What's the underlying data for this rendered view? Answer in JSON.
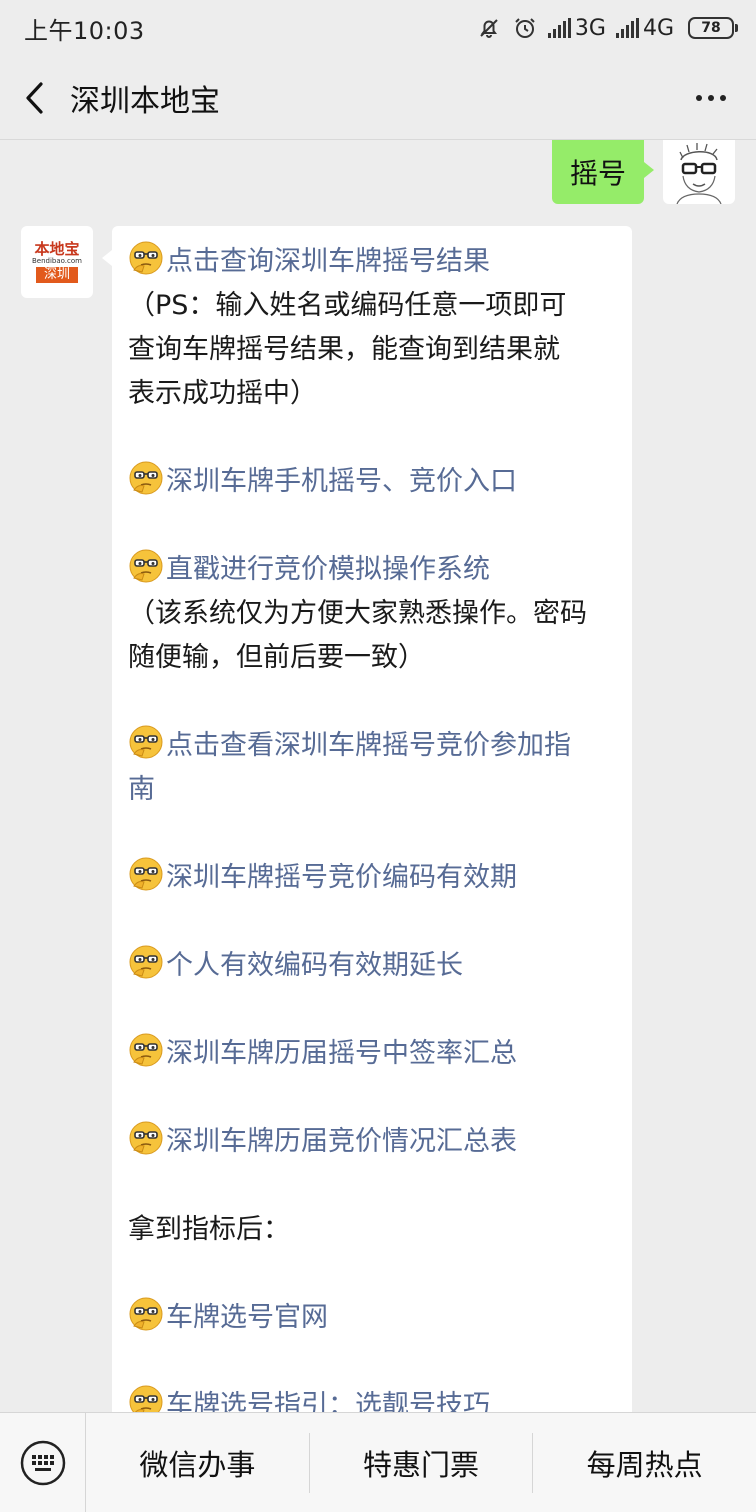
{
  "status_bar": {
    "time": "上午10:03",
    "network_1": "3G",
    "network_2": "4G",
    "battery": "78"
  },
  "header": {
    "title": "深圳本地宝",
    "back_icon": "chevron-left-icon",
    "more_icon": "more-dots-icon"
  },
  "messages": {
    "user_text": "摇号",
    "bot_avatar": {
      "logo_cn": "本地宝",
      "logo_en": "Bendibao.com",
      "logo_city": "深圳"
    },
    "bot_lines": [
      {
        "kind": "link",
        "emoji": true,
        "text": "点击查询深圳车牌摇号结果"
      },
      {
        "kind": "text",
        "text": "（PS：输入姓名或编码任意一项即可"
      },
      {
        "kind": "text",
        "text": "查询车牌摇号结果，能查询到结果就"
      },
      {
        "kind": "text",
        "text": "表示成功摇中）"
      },
      {
        "kind": "gap"
      },
      {
        "kind": "link",
        "emoji": true,
        "text": "深圳车牌手机摇号、竞价入口"
      },
      {
        "kind": "gap"
      },
      {
        "kind": "link",
        "emoji": true,
        "text": "直戳进行竞价模拟操作系统"
      },
      {
        "kind": "text",
        "text": "（该系统仅为方便大家熟悉操作。密码"
      },
      {
        "kind": "text",
        "text": "随便输，但前后要一致）"
      },
      {
        "kind": "gap"
      },
      {
        "kind": "link",
        "emoji": true,
        "text": "点击查看深圳车牌摇号竞价参加指"
      },
      {
        "kind": "link",
        "emoji": false,
        "text": "南"
      },
      {
        "kind": "gap"
      },
      {
        "kind": "link",
        "emoji": true,
        "text": "深圳车牌摇号竞价编码有效期"
      },
      {
        "kind": "gap"
      },
      {
        "kind": "link",
        "emoji": true,
        "text": "个人有效编码有效期延长"
      },
      {
        "kind": "gap"
      },
      {
        "kind": "link",
        "emoji": true,
        "text": "深圳车牌历届摇号中签率汇总"
      },
      {
        "kind": "gap"
      },
      {
        "kind": "link",
        "emoji": true,
        "text": "深圳车牌历届竞价情况汇总表"
      },
      {
        "kind": "gap"
      },
      {
        "kind": "text",
        "text": "拿到指标后："
      },
      {
        "kind": "gap"
      },
      {
        "kind": "link",
        "emoji": true,
        "text": "车牌选号官网"
      },
      {
        "kind": "gap"
      },
      {
        "kind": "link",
        "emoji": true,
        "text": "车牌选号指引：选靓号技巧"
      }
    ],
    "emoji_icon": "thinking-face-emoji-icon"
  },
  "bottom_menu": {
    "keyboard_icon": "keyboard-icon",
    "items": [
      "微信办事",
      "特惠门票",
      "每周热点"
    ]
  },
  "colors": {
    "background": "#ededed",
    "user_bubble": "#95ec69",
    "link": "#576b95",
    "logo_orange": "#e25a1c"
  }
}
